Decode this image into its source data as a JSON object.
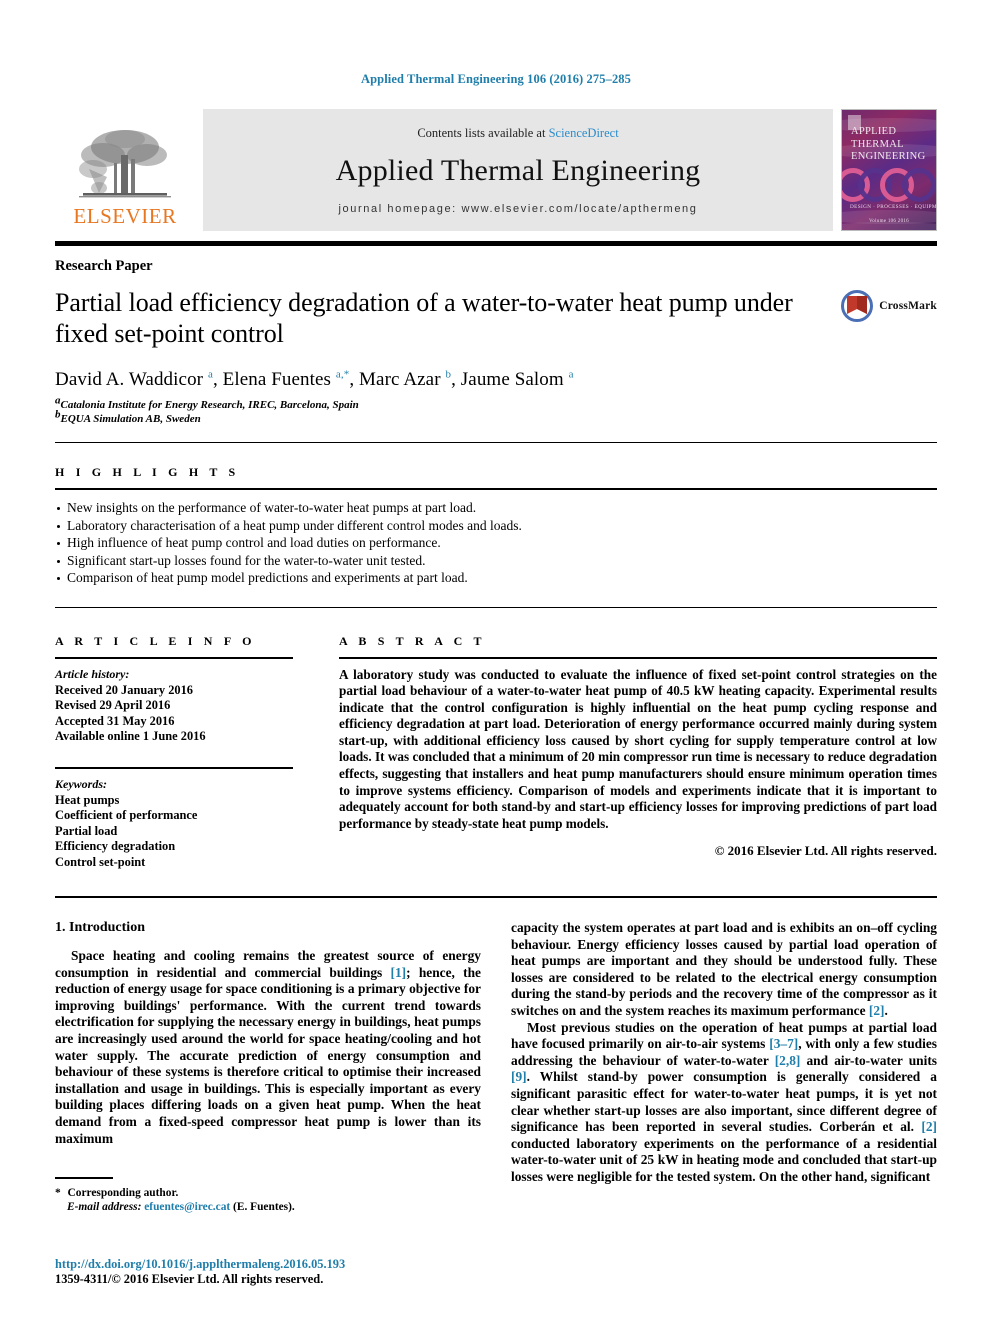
{
  "running_head": "Applied Thermal Engineering 106 (2016) 275–285",
  "masthead": {
    "publisher_name": "ELSEVIER",
    "contents_prefix": "Contents lists available at ",
    "contents_link": "ScienceDirect",
    "journal_name": "Applied Thermal Engineering",
    "homepage": "journal homepage: www.elsevier.com/locate/apthermeng",
    "cover": {
      "line1": "APPLIED",
      "line2": "THERMAL",
      "line3": "ENGINEERING",
      "footer_line": "DESIGN · PROCESSES · EQUIPMENT · ECONOMICS",
      "volume_line": "Volume 106   2016"
    }
  },
  "article": {
    "kind": "Research Paper",
    "title": "Partial load efficiency degradation of a water-to-water heat pump under fixed set-point control",
    "crossmark_label": "CrossMark",
    "authors_html": "David A. Waddicor <sup>a</sup>, Elena Fuentes <sup>a,*</sup>, Marc Azar <sup>b</sup>, Jaume Salom <sup>a</sup>",
    "affiliations": [
      {
        "marker": "a",
        "text": "Catalonia Institute for Energy Research, IREC, Barcelona, Spain"
      },
      {
        "marker": "b",
        "text": "EQUA Simulation AB, Sweden"
      }
    ]
  },
  "highlights": {
    "heading": "H I G H L I G H T S",
    "items": [
      "New insights on the performance of water-to-water heat pumps at part load.",
      "Laboratory characterisation of a heat pump under different control modes and loads.",
      "High influence of heat pump control and load duties on performance.",
      "Significant start-up losses found for the water-to-water unit tested.",
      "Comparison of heat pump model predictions and experiments at part load."
    ]
  },
  "article_info": {
    "heading": "A R T I C L E    I N F O",
    "history_label": "Article history:",
    "history": [
      "Received 20 January 2016",
      "Revised 29 April 2016",
      "Accepted 31 May 2016",
      "Available online 1 June 2016"
    ],
    "keywords_label": "Keywords:",
    "keywords": [
      "Heat pumps",
      "Coefficient of performance",
      "Partial load",
      "Efficiency degradation",
      "Control set-point"
    ]
  },
  "abstract": {
    "heading": "A B S T R A C T",
    "text": "A laboratory study was conducted to evaluate the influence of fixed set-point control strategies on the partial load behaviour of a water-to-water heat pump of 40.5 kW heating capacity. Experimental results indicate that the control configuration is highly influential on the heat pump cycling response and efficiency degradation at part load. Deterioration of energy performance occurred mainly during system start-up, with additional efficiency loss caused by short cycling for supply temperature control at low loads. It was concluded that a minimum of 20 min compressor run time is necessary to reduce degradation effects, suggesting that installers and heat pump manufacturers should ensure minimum operation times to improve systems efficiency. Comparison of models and experiments indicate that it is important to adequately account for both stand-by and start-up efficiency losses for improving predictions of part load performance by steady-state heat pump models.",
    "copyright": "© 2016 Elsevier Ltd. All rights reserved."
  },
  "body": {
    "section_heading": "1. Introduction",
    "left_paragraph_1_html": "Space heating and cooling remains the greatest source of energy consumption in residential and commercial buildings <span class=\"ref\">[1]</span>; hence, the reduction of energy usage for space conditioning is a primary objective for improving buildings' performance. With the current trend towards electrification for supplying the necessary energy in buildings, heat pumps are increasingly used around the world for space heating/cooling and hot water supply. The accurate prediction of energy consumption and behaviour of these systems is therefore critical to optimise their increased installation and usage in buildings. This is especially important as every building places differing loads on a given heat pump. When the heat demand from a fixed-speed compressor heat pump is lower than its maximum",
    "right_paragraph_1_html": "capacity the system operates at part load and is exhibits an on&ndash;off cycling behaviour. Energy efficiency losses caused by partial load operation of heat pumps are important and they should be understood fully. These losses are considered to be related to the electrical energy consumption during the stand-by periods and the recovery time of the compressor as it switches on and the system reaches its maximum performance <span class=\"ref\">[2]</span>.",
    "right_paragraph_2_html": "Most previous studies on the operation of heat pumps at partial load have focused primarily on air-to-air systems <span class=\"ref\">[3&ndash;7]</span>, with only a few studies addressing the behaviour of water-to-water <span class=\"ref\">[2,8]</span> and air-to-water units <span class=\"ref\">[9]</span>. Whilst stand-by power consumption is generally considered a significant parasitic effect for water-to-water heat pumps, it is yet not clear whether start-up losses are also important, since different degree of significance has been reported in several studies. Corberán et al. <span class=\"ref\">[2]</span> conducted laboratory experiments on the performance of a residential water-to-water unit of 25 kW in heating mode and concluded that start-up losses were negligible for the tested system. On the other hand, significant",
    "footnote_html": "<span class=\"star\">*</span> Corresponding author.",
    "footnote_email_html": "<span class=\"em\">E-mail address:</span> <span class=\"link\">efuentes@irec.cat</span> (E. Fuentes)."
  },
  "page_footer": {
    "doi": "http://dx.doi.org/10.1016/j.applthermaleng.2016.05.193",
    "issn_line": "1359-4311/© 2016 Elsevier Ltd. All rights reserved."
  },
  "colors": {
    "link_blue": "#1f7eaa",
    "sciencedirect_blue": "#2b8ccc",
    "elsevier_orange": "#e87722",
    "masthead_gray": "#e6e6e6"
  }
}
